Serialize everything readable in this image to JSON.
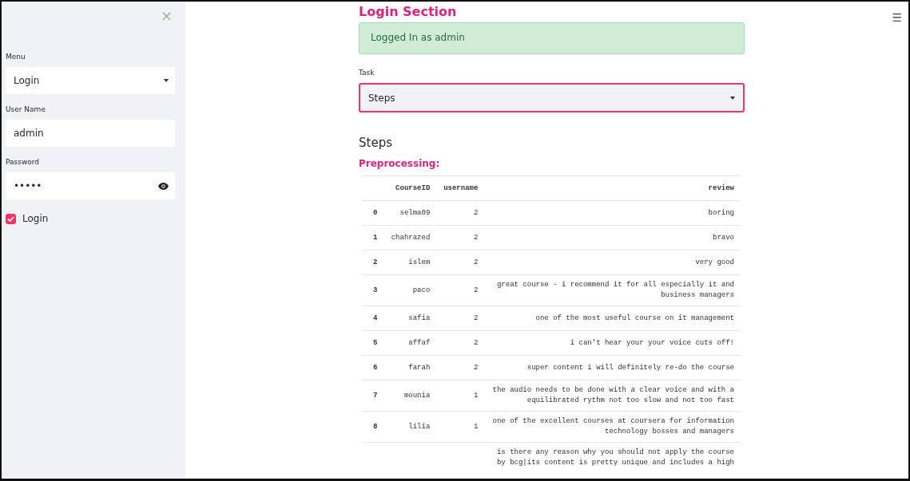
{
  "sidebar": {
    "close": "×",
    "fields": [
      {
        "kind": "select",
        "label": "Menu",
        "value": "Login"
      },
      {
        "kind": "text",
        "label": "User Name",
        "value": "admin"
      },
      {
        "kind": "password",
        "label": "Password",
        "value": "•••••"
      }
    ],
    "checkbox": {
      "label": "Login",
      "checked": true
    }
  },
  "menu_icon": "☰",
  "main": {
    "title": "Login Section",
    "alert": "Logged In as admin",
    "task": {
      "label": "Task",
      "value": "Steps",
      "focused": true
    },
    "subheader": "Steps",
    "section": "Preprocessing:",
    "table": {
      "columns": [
        "",
        "CourseID",
        "username",
        "review"
      ],
      "rows": [
        [
          "0",
          "selma09",
          "2",
          "boring"
        ],
        [
          "1",
          "chahrazed",
          "2",
          "bravo"
        ],
        [
          "2",
          "islem",
          "2",
          "very good"
        ],
        [
          "3",
          "paco",
          "2",
          "great course - i recommend it for all especially it and business managers"
        ],
        [
          "4",
          "safia",
          "2",
          "one of the most useful course on it management"
        ],
        [
          "5",
          "affaf",
          "2",
          "i can't hear your your voice cuts off!"
        ],
        [
          "6",
          "farah",
          "2",
          "super content i will definitely re-do the course"
        ],
        [
          "7",
          "mounia",
          "1",
          "the audio needs to be done with a clear voice and with a equilibrated rythm not too slow and not too fast"
        ],
        [
          "8",
          "lilia",
          "1",
          "one of the excellent courses at coursera for information technology bosses and managers"
        ],
        [
          "",
          "",
          "",
          "is there any reason why you should not apply the course by bcg|its content is pretty unique and includes a high"
        ]
      ]
    }
  }
}
